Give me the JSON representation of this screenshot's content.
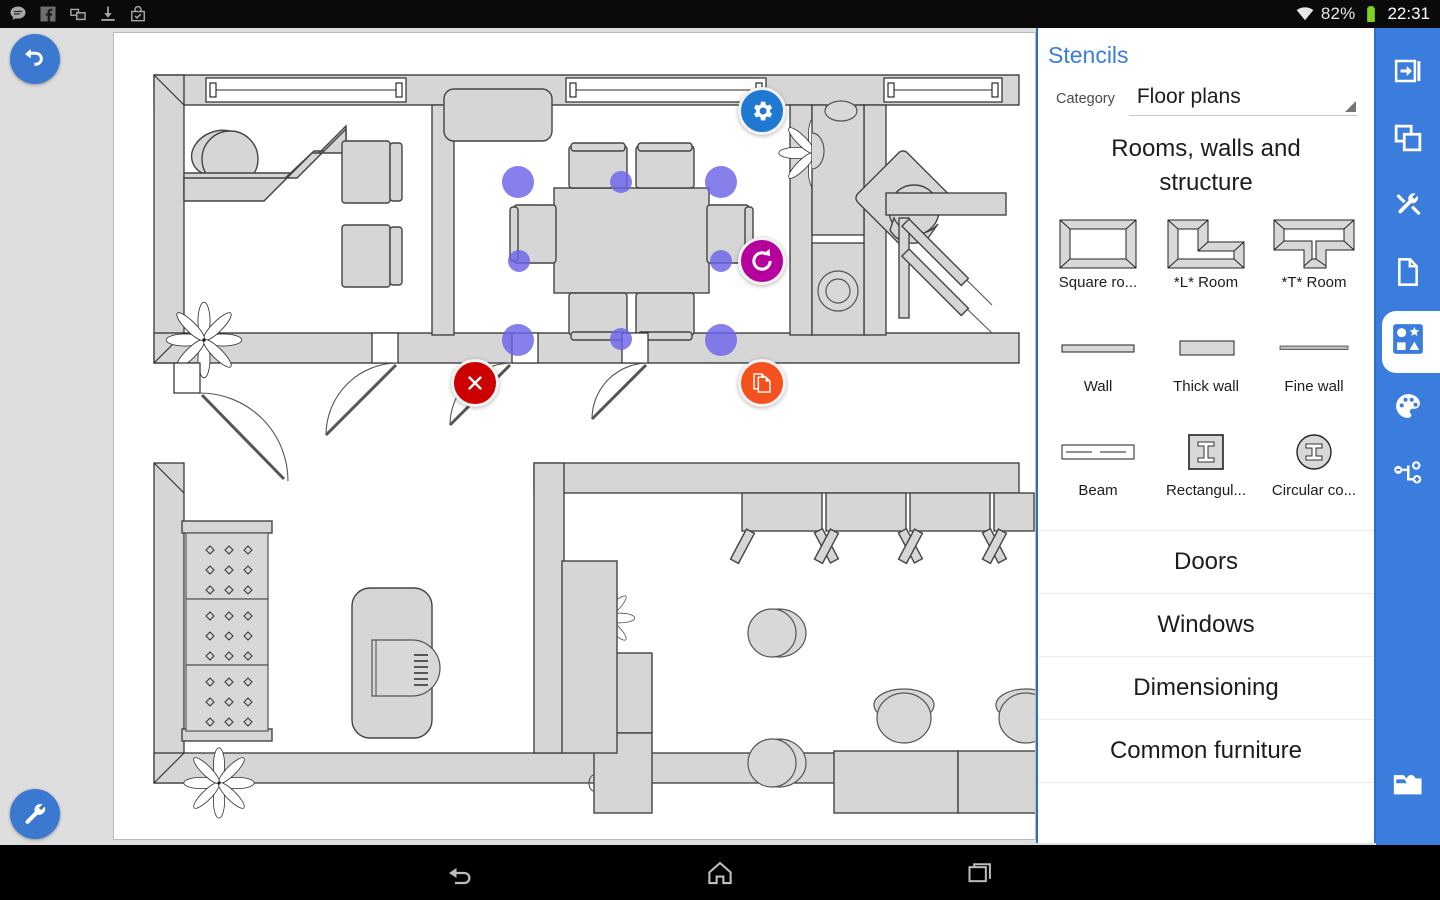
{
  "status_bar": {
    "left_icons": [
      "message-icon",
      "facebook-icon",
      "copy-icon",
      "download-icon",
      "shopping-bag-icon"
    ],
    "wifi_icon": "wifi-icon",
    "battery_percent": "82%",
    "battery_icon": "battery-icon",
    "time": "22:31",
    "battery_color": "#7ed321"
  },
  "canvas": {
    "undo_button": "undo-icon",
    "settings_button": "gear-icon",
    "tools_button": "wrench-icon",
    "rotate_button": "rotate-icon",
    "delete_button": "close-icon",
    "duplicate_button": "duplicate-icon"
  },
  "stencils": {
    "title": "Stencils",
    "category_label": "Category",
    "category_value": "Floor plans",
    "section_title": "Rooms, walls and structure",
    "items": [
      {
        "label": "Square ro...",
        "icon": "square-room-icon"
      },
      {
        "label": "*L* Room",
        "icon": "l-room-icon"
      },
      {
        "label": "*T* Room",
        "icon": "t-room-icon"
      },
      {
        "label": "Wall",
        "icon": "wall-icon"
      },
      {
        "label": "Thick wall",
        "icon": "thick-wall-icon"
      },
      {
        "label": "Fine wall",
        "icon": "fine-wall-icon"
      },
      {
        "label": "Beam",
        "icon": "beam-icon"
      },
      {
        "label": "Rectangul...",
        "icon": "rectangular-column-icon"
      },
      {
        "label": "Circular co...",
        "icon": "circular-column-icon"
      }
    ],
    "sections": [
      {
        "label": "Doors"
      },
      {
        "label": "Windows"
      },
      {
        "label": "Dimensioning"
      },
      {
        "label": "Common furniture"
      }
    ],
    "accent_color": "#3b7ddd"
  },
  "toolbar": {
    "buttons": [
      {
        "name": "collapse-panel-icon",
        "selected": false
      },
      {
        "name": "layers-icon",
        "selected": false
      },
      {
        "name": "tools-icon",
        "selected": false
      },
      {
        "name": "document-icon",
        "selected": false
      },
      {
        "name": "stencils-icon",
        "selected": true
      },
      {
        "name": "palette-icon",
        "selected": false
      },
      {
        "name": "connector-icon",
        "selected": false
      }
    ],
    "bottom_button": {
      "name": "folder-open-icon"
    },
    "background_color": "#3b7ddd"
  },
  "navbar": {
    "back": "back-icon",
    "home": "home-icon",
    "recents": "recents-icon"
  }
}
